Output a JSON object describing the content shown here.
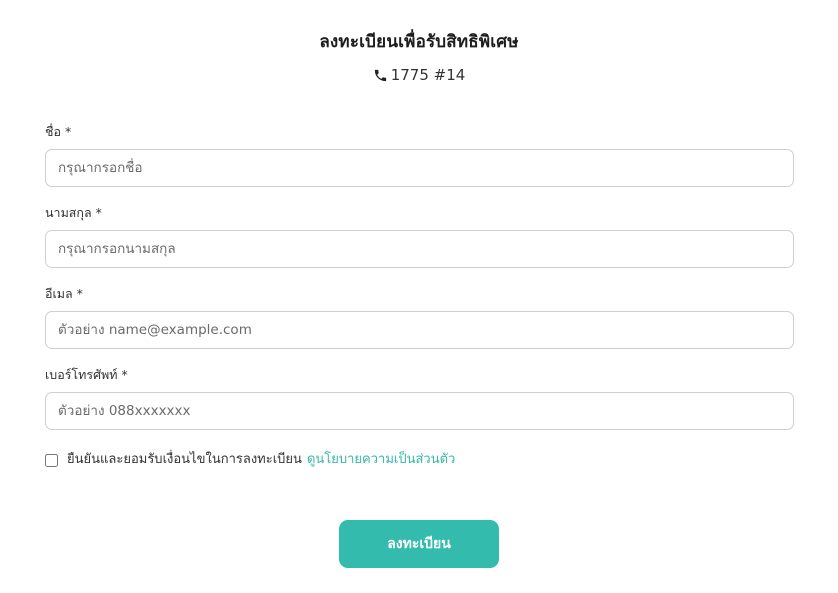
{
  "header": {
    "title": "ลงทะเบียนเพื่อรับสิทธิพิเศษ",
    "phone_icon": "phone-icon",
    "phone_text": "1775 #14"
  },
  "form": {
    "fields": [
      {
        "label": "ชื่อ *",
        "placeholder": "กรุณากรอกชื่อ",
        "value": ""
      },
      {
        "label": "นามสกุล *",
        "placeholder": "กรุณากรอกนามสกุล",
        "value": ""
      },
      {
        "label": "อีเมล *",
        "placeholder": "ตัวอย่าง name@example.com",
        "value": ""
      },
      {
        "label": "เบอร์โทรศัพท์ *",
        "placeholder": "ตัวอย่าง 088xxxxxxx",
        "value": ""
      }
    ],
    "consent": {
      "checked": false,
      "text": "ยืนยันและยอมรับเงื่อนไขในการลงทะเบียน",
      "link_text": "ดูนโยบายความเป็นส่วนตัว"
    },
    "submit_label": "ลงทะเบียน"
  },
  "colors": {
    "accent": "#33bbad",
    "link": "#35b9a8",
    "border": "#cfcfcf"
  }
}
